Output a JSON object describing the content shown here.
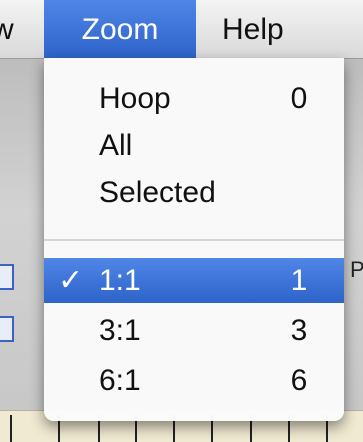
{
  "menubar": {
    "prev_label": "w",
    "zoom_label": "Zoom",
    "help_label": "Help"
  },
  "background": {
    "edge_letter": "P"
  },
  "menu": {
    "items": [
      {
        "label": "Hoop",
        "key": "0"
      },
      {
        "label": "All",
        "key": ""
      },
      {
        "label": "Selected",
        "key": ""
      },
      {
        "label": "1:1",
        "key": "1",
        "checked": true
      },
      {
        "label": "3:1",
        "key": "3"
      },
      {
        "label": "6:1",
        "key": "6"
      }
    ],
    "check_glyph": "✓",
    "highlight_color": "#3a70d8"
  }
}
